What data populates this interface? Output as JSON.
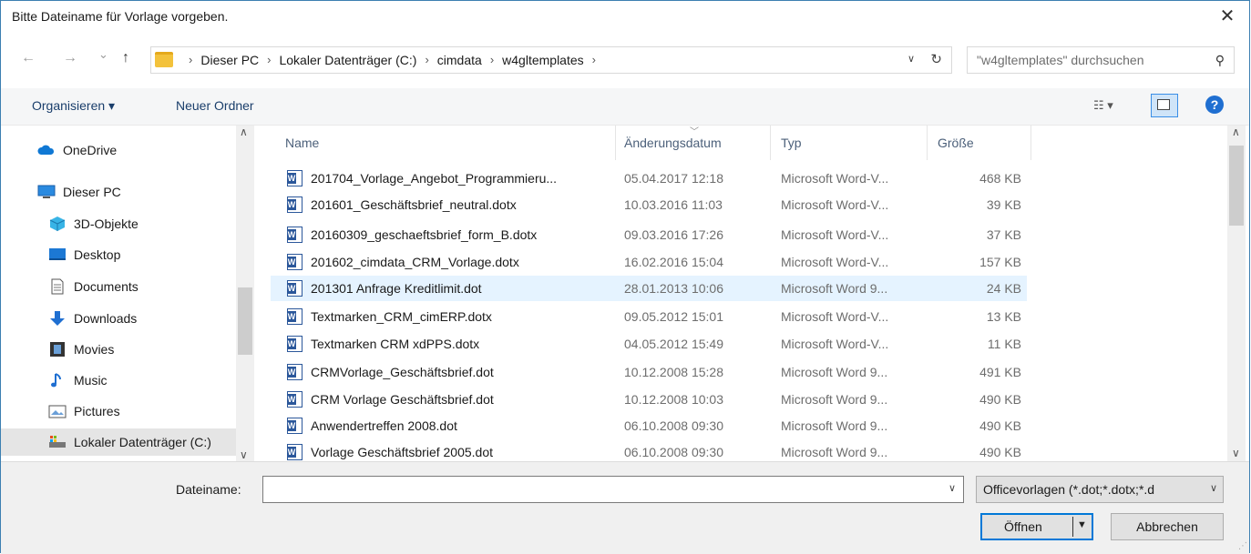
{
  "dialog": {
    "title": "Bitte Dateiname für Vorlage vorgeben.",
    "close_glyph": "✕"
  },
  "nav": {
    "back": "←",
    "forward": "→",
    "recent": "⌄",
    "up": "↑",
    "breadcrumbs": [
      "Dieser PC",
      "Lokaler Datenträger (C:)",
      "cimdata",
      "w4gltemplates"
    ],
    "separator": "›",
    "search_placeholder": "\"w4gltemplates\" durchsuchen"
  },
  "toolbar": {
    "organize": "Organisieren ▾",
    "new_folder": "Neuer Ordner",
    "view_glyph": "☷ ▾",
    "help": "?"
  },
  "sidebar": {
    "items": [
      {
        "label": "OneDrive",
        "icon": "cloud-icon"
      },
      {
        "label": "Dieser PC",
        "icon": "computer-icon"
      },
      {
        "label": "3D-Objekte",
        "icon": "cube-icon"
      },
      {
        "label": "Desktop",
        "icon": "desktop-icon"
      },
      {
        "label": "Documents",
        "icon": "document-icon"
      },
      {
        "label": "Downloads",
        "icon": "download-icon"
      },
      {
        "label": "Movies",
        "icon": "film-icon"
      },
      {
        "label": "Music",
        "icon": "music-icon"
      },
      {
        "label": "Pictures",
        "icon": "picture-icon"
      },
      {
        "label": "Lokaler Datenträger (C:)",
        "icon": "drive-icon"
      }
    ]
  },
  "columns": {
    "name": "Name",
    "date": "Änderungsdatum",
    "type": "Typ",
    "size": "Größe"
  },
  "files": [
    {
      "name": "201704_Vorlage_Angebot_Programmieru...",
      "date": "05.04.2017 12:18",
      "type": "Microsoft Word-V...",
      "size": "468 KB"
    },
    {
      "name": "201601_Geschäftsbrief_neutral.dotx",
      "date": "10.03.2016 11:03",
      "type": "Microsoft Word-V...",
      "size": "39 KB"
    },
    {
      "name": "20160309_geschaeftsbrief_form_B.dotx",
      "date": "09.03.2016 17:26",
      "type": "Microsoft Word-V...",
      "size": "37 KB"
    },
    {
      "name": "201602_cimdata_CRM_Vorlage.dotx",
      "date": "16.02.2016 15:04",
      "type": "Microsoft Word-V...",
      "size": "157 KB"
    },
    {
      "name": "201301 Anfrage Kreditlimit.dot",
      "date": "28.01.2013 10:06",
      "type": "Microsoft Word 9...",
      "size": "24 KB"
    },
    {
      "name": "Textmarken_CRM_cimERP.dotx",
      "date": "09.05.2012 15:01",
      "type": "Microsoft Word-V...",
      "size": "13 KB"
    },
    {
      "name": "Textmarken CRM xdPPS.dotx",
      "date": "04.05.2012 15:49",
      "type": "Microsoft Word-V...",
      "size": "11 KB"
    },
    {
      "name": "CRMVorlage_Geschäftsbrief.dot",
      "date": "10.12.2008 15:28",
      "type": "Microsoft Word 9...",
      "size": "491 KB"
    },
    {
      "name": "CRM Vorlage Geschäftsbrief.dot",
      "date": "10.12.2008 10:03",
      "type": "Microsoft Word 9...",
      "size": "490 KB"
    },
    {
      "name": "Anwendertreffen 2008.dot",
      "date": "06.10.2008 09:30",
      "type": "Microsoft Word 9...",
      "size": "490 KB"
    },
    {
      "name": "Vorlage Geschäftsbrief 2005.dot",
      "date": "06.10.2008 09:30",
      "type": "Microsoft Word 9...",
      "size": "490 KB"
    }
  ],
  "bottom": {
    "filename_label": "Dateiname:",
    "filename_value": "",
    "filter": "Officevorlagen (*.dot;*.dotx;*.d",
    "open": "Öffnen",
    "cancel": "Abbrechen"
  },
  "colors": {
    "accent": "#0078d7",
    "selection": "#e5f3ff",
    "word_blue": "#2b579a"
  }
}
